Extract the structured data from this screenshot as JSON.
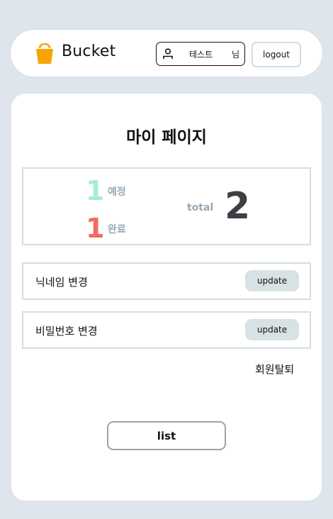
{
  "header": {
    "logo_icon": "bucket-icon",
    "logo_text": "Bucket",
    "user_icon": "user-icon",
    "user_name": "테스트",
    "user_suffix": "님",
    "logout_label": "logout"
  },
  "page": {
    "title": "마이 페이지",
    "stats": {
      "planned_count": "1",
      "planned_label": "예정",
      "done_count": "1",
      "done_label": "완료",
      "total_label": "total",
      "total_count": "2"
    },
    "settings": [
      {
        "label": "닉네임 변경",
        "button_label": "update"
      },
      {
        "label": "비밀번호 변경",
        "button_label": "update"
      }
    ],
    "withdraw_label": "회원탈퇴",
    "list_label": "list"
  },
  "colors": {
    "background": "#dfe5ec",
    "logo_orange": "#f7a400",
    "planned_green": "#a7ecd9",
    "done_red": "#f26b62",
    "total_dark": "#3d3f44",
    "button_gray": "#d7e2e4"
  }
}
